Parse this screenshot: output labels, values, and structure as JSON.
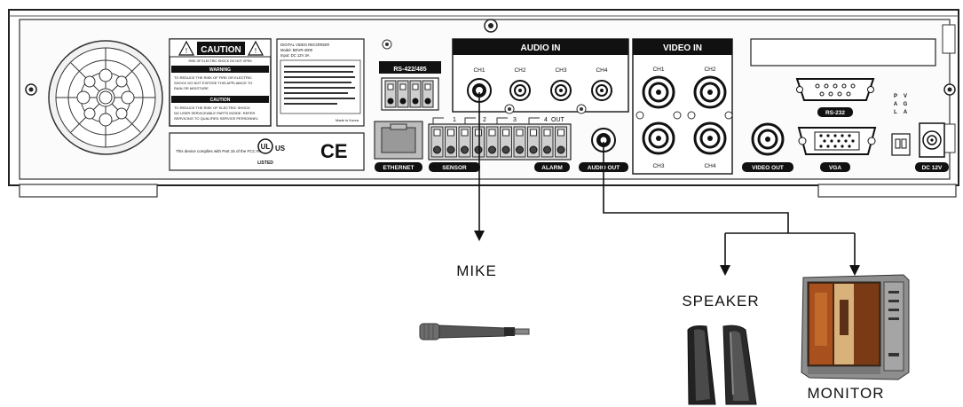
{
  "panel": {
    "caution_title": "CAUTION",
    "caution_sub": "RISK OF ELECTRIC SHOCK DO NOT OPEN",
    "warning_title": "WARNING",
    "warning_text_1": "TO REDUCE THE RISK OF FIRE OR ELECTRIC",
    "warning_text_2": "SHOCK DO NOT EXPOSE THIS APPLIANCE TO",
    "warning_text_3": "RAIN OR MOISTURE",
    "caution2_title": "CAUTION",
    "caution2_text_1": "TO REDUCE THE RISK OF ELECTRIC SHOCK",
    "caution2_text_2": "NO USER SERVICEABLE PARTS INSIDE. REFER",
    "caution2_text_3": "SERVICING TO QUALIFIED SERVICE PERSONNEL",
    "model_line_1": "DIGITAL VIDEO RECORDER",
    "model_line_2": "Model: BDVR-4000",
    "model_line_3": "Input: DC 12V 3A",
    "fcc_note": "This device complies with Part 15 of the FCC Rules.",
    "made_in": "Made in Korea",
    "fcc_small": "This device complies with Part 15 of the FCC Rules.",
    "ul_text": "US",
    "ul_listed": "LISTED",
    "ce_mark": "CE",
    "rs422_label": "RS-422/485",
    "audio_in_title": "AUDIO IN",
    "audio_channels": [
      "CH1",
      "CH2",
      "CH3",
      "CH4"
    ],
    "video_in_title": "VIDEO IN",
    "video_channels": [
      "CH1",
      "CH2",
      "CH3",
      "CH4"
    ],
    "ethernet_label": "ETHERNET",
    "sensor_label": "SENSOR",
    "alarm_label": "ALARM",
    "sensor_numbers": [
      "1",
      "2",
      "3",
      "4"
    ],
    "out_label": "OUT",
    "audio_out_label": "AUDIO OUT",
    "video_out_label": "VIDEO OUT",
    "rs232_label": "RS-232",
    "vga_label": "VGA",
    "switch_left": "P A L",
    "switch_right": "V G A",
    "dc_label": "DC 12V"
  },
  "devices": {
    "mike": "MIKE",
    "speaker": "SPEAKER",
    "monitor": "MONITOR"
  }
}
